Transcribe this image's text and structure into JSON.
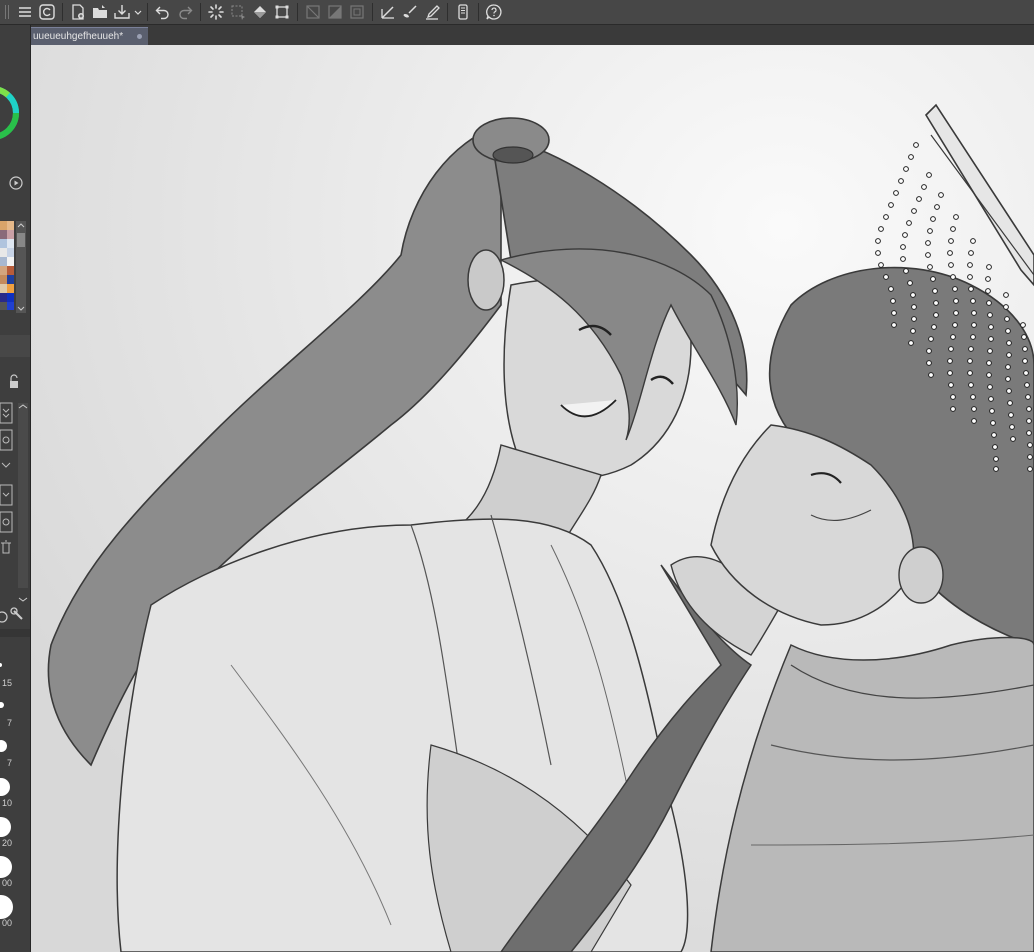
{
  "document": {
    "tab_title": "uueueuhgefheuueh*"
  },
  "brush_sizes": [
    "15",
    "7",
    "7",
    "10",
    "20",
    "00",
    "00"
  ],
  "colors": {
    "toolbar_bg": "#474747",
    "panel_bg": "#3e3e3e",
    "tab_active": "#5a5f6e",
    "canvas_bg": "#eaeaea",
    "ink": "#3a3a3a",
    "shade": "#8a8a8a"
  },
  "icons": [
    "menu-icon",
    "app-logo-icon",
    "new-file-icon",
    "open-folder-icon",
    "save-icon",
    "undo-icon",
    "redo-icon",
    "loading-spinner-icon",
    "select-all-icon",
    "fill-icon",
    "transform-icon",
    "clear-icon",
    "invert-selection-icon",
    "border-icon",
    "ruler-icon",
    "brush-icon",
    "pen-icon",
    "smartphone-icon",
    "help-icon"
  ]
}
